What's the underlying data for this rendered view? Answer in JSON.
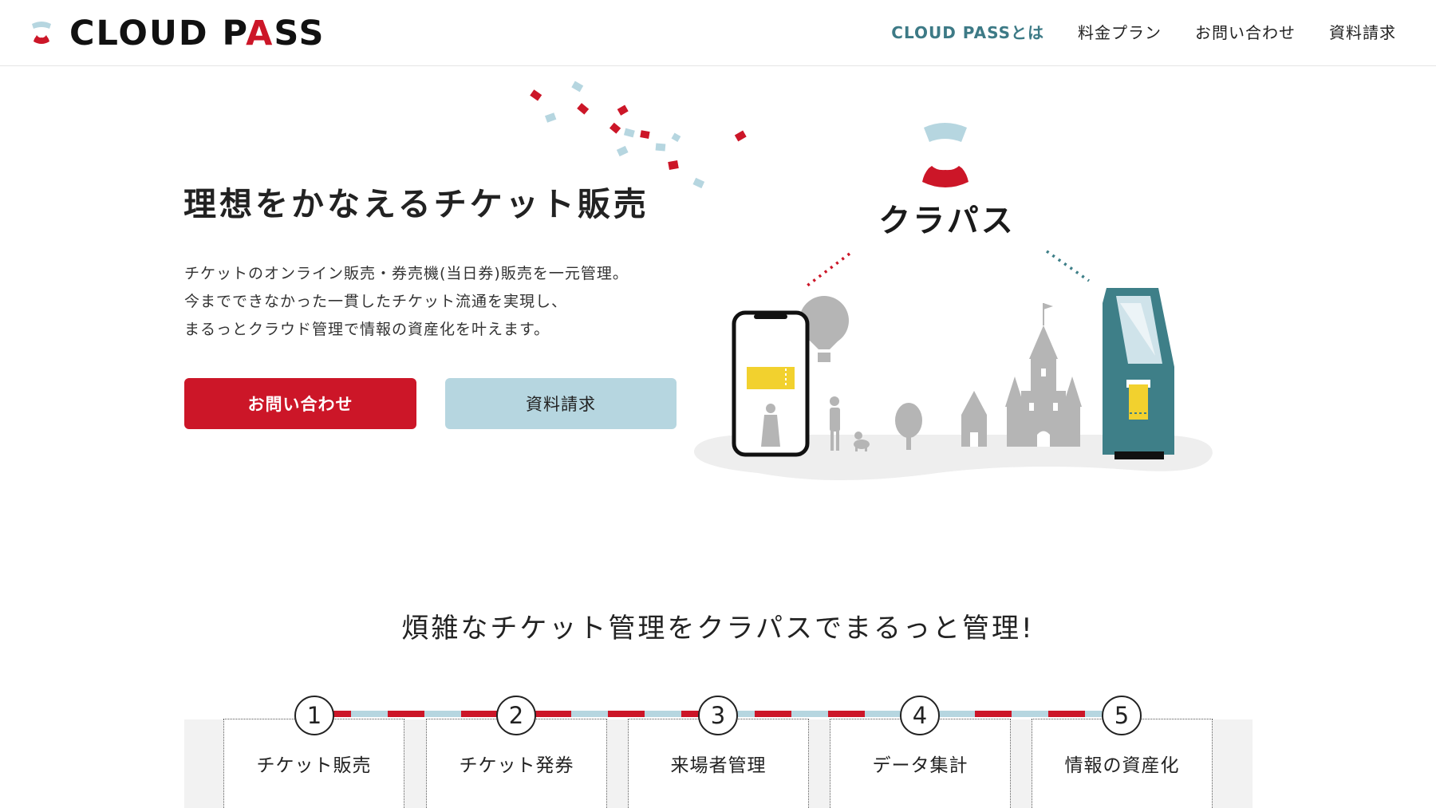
{
  "header": {
    "logo_text_pre": "CLOUD P",
    "logo_text_a": "A",
    "logo_text_post": "SS",
    "nav": [
      {
        "label": "CLOUD PASSとは"
      },
      {
        "label": "料金プラン"
      },
      {
        "label": "お問い合わせ"
      },
      {
        "label": "資料請求"
      }
    ]
  },
  "hero": {
    "title": "理想をかなえるチケット販売",
    "desc_lines": [
      "チケットのオンライン販売・券売機(当日券)販売を一元管理。",
      "今までできなかった一貫したチケット流通を実現し、",
      "まるっとクラウド管理で情報の資産化を叶えます。"
    ],
    "contact_button": "お問い合わせ",
    "docs_button": "資料請求",
    "illustration_label": "クラパス"
  },
  "section2": {
    "title": "煩雑なチケット管理をクラパスでまるっと管理!",
    "steps": [
      {
        "num": "1",
        "label": "チケット販売"
      },
      {
        "num": "2",
        "label": "チケット発券"
      },
      {
        "num": "3",
        "label": "来場者管理"
      },
      {
        "num": "4",
        "label": "データ集計"
      },
      {
        "num": "5",
        "label": "情報の資産化"
      }
    ]
  },
  "colors": {
    "brand_red": "#cc1628",
    "brand_light_blue": "#b6d6e0",
    "brand_teal": "#3d7a86",
    "kiosk_teal": "#3e7f88",
    "ticket_yellow": "#f2d12e"
  }
}
